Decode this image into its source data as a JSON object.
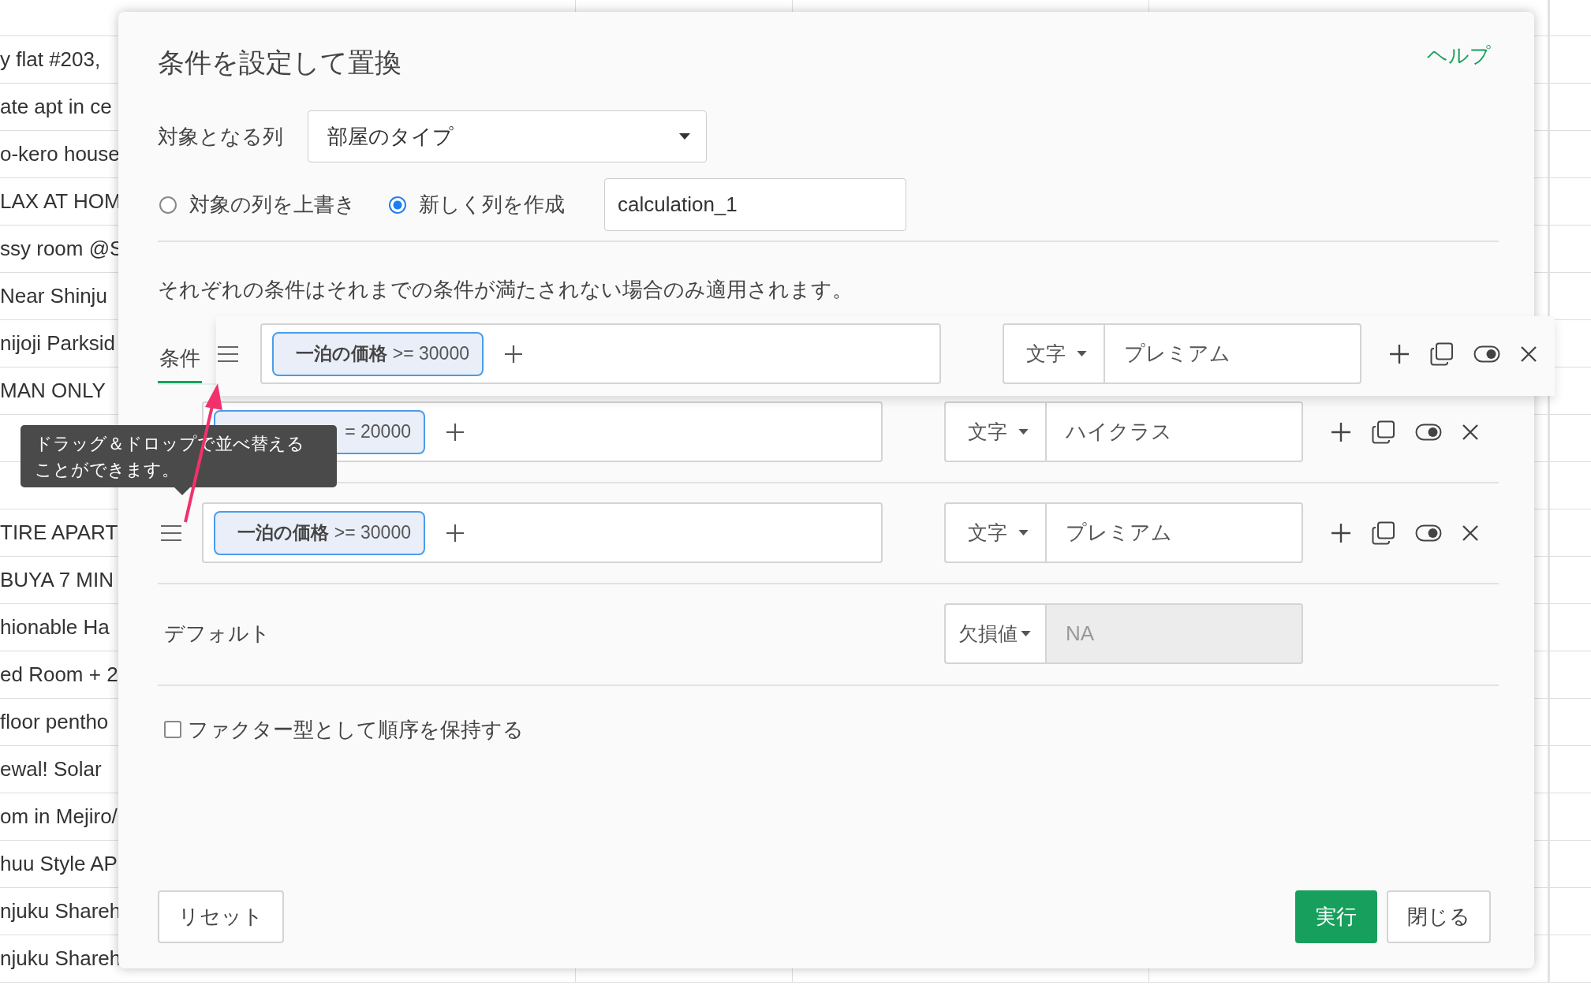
{
  "spreadsheet": {
    "first_column_upper": [
      "y flat #203,",
      "ate apt in ce",
      "o-kero house",
      "LAX AT HOM",
      "ssy room @S",
      "Near Shinju",
      "nijoji Parksid",
      "MAN ONLY"
    ],
    "first_column_lower": [
      "TIRE APART",
      "BUYA 7 MIN",
      "hionable Ha",
      "ed Room + 2",
      "floor pentho",
      "ewal! Solar",
      "om in Mejiro/",
      "huu Style AP",
      "njuku Shareh",
      "njuku Shareh"
    ]
  },
  "dialog": {
    "title": "条件を設定して置換",
    "help_link": "ヘルプ",
    "target_column": {
      "label": "対象となる列",
      "value": "部屋のタイプ"
    },
    "output_mode": [
      {
        "label": "対象の列を上書き",
        "selected": false
      },
      {
        "label": "新しく列を作成",
        "selected": true
      }
    ],
    "new_column_name": {
      "value": "calculation_1"
    },
    "note": "それぞれの条件はそれまでの条件が満たされない場合のみ適用されます。",
    "tabs": [
      {
        "label": "条件",
        "selected": true
      }
    ],
    "dragged_row": {
      "handle": true,
      "condition": "**一泊の価格** >= 30000",
      "type": "文字",
      "value": "プレミアム"
    },
    "rows": [
      {
        "handle": false,
        "condition": "= 20000",
        "type": "文字",
        "value": "ハイクラス"
      },
      {
        "handle": true,
        "condition": "**一泊の価格** >= 30000",
        "type": "文字",
        "value": "プレミアム"
      }
    ],
    "default": {
      "label": "デフォルト",
      "type": "欠損値",
      "placeholder": "NA",
      "disabled": true
    },
    "keep_factor": {
      "label": "ファクター型として順序を保持する",
      "checked": false
    },
    "buttons": [
      {
        "label": "リセット",
        "kind": "default"
      },
      {
        "label": "実行",
        "kind": "primary"
      },
      {
        "label": "閉じる",
        "kind": "default"
      }
    ]
  },
  "tooltip": {
    "lines": [
      "ドラッグ＆ドロップで並べ替える",
      "ことができます。"
    ]
  }
}
